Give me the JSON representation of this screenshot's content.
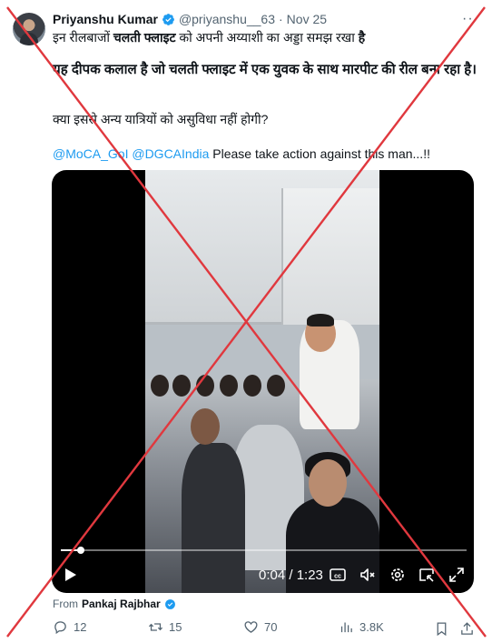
{
  "tweet": {
    "display_name": "Priyanshu Kumar",
    "handle": "@priyanshu__63",
    "separator": "·",
    "date": "Nov 25",
    "line1_pre": "इन रीलबाजों ",
    "line1_bold": "चलती फ्लाइट",
    "line1_mid": " को अपनी अय्याशी का अड्डा समझ रखा ",
    "line1_end": "है",
    "line2": "यह दीपक कलाल है जो चलती फ्लाइट में एक युवक के साथ मारपीट की रील बना रहा है।",
    "line3": "क्या इससे अन्य यात्रियों को असुविधा नहीं होगी?",
    "mention1": "@MoCA_GoI",
    "mention2": "@DGCAIndia",
    "line4_rest": " Please take action against this man...!!"
  },
  "video": {
    "time": "0:04 / 1:23",
    "progress": 0.05
  },
  "from": {
    "label": "From",
    "name": "Pankaj Rajbhar"
  },
  "actions": {
    "replies": "12",
    "reposts": "15",
    "likes": "70",
    "views": "3.8K"
  },
  "colors": {
    "accent": "#1d9bf0",
    "cross": "#e0383e",
    "muted": "#536471"
  },
  "icons": [
    "verified-icon",
    "more-icon",
    "play-icon",
    "captions-icon",
    "mute-icon",
    "settings-icon",
    "pip-icon",
    "fullscreen-icon",
    "reply-icon",
    "repost-icon",
    "like-icon",
    "views-icon",
    "bookmark-icon",
    "share-icon"
  ]
}
